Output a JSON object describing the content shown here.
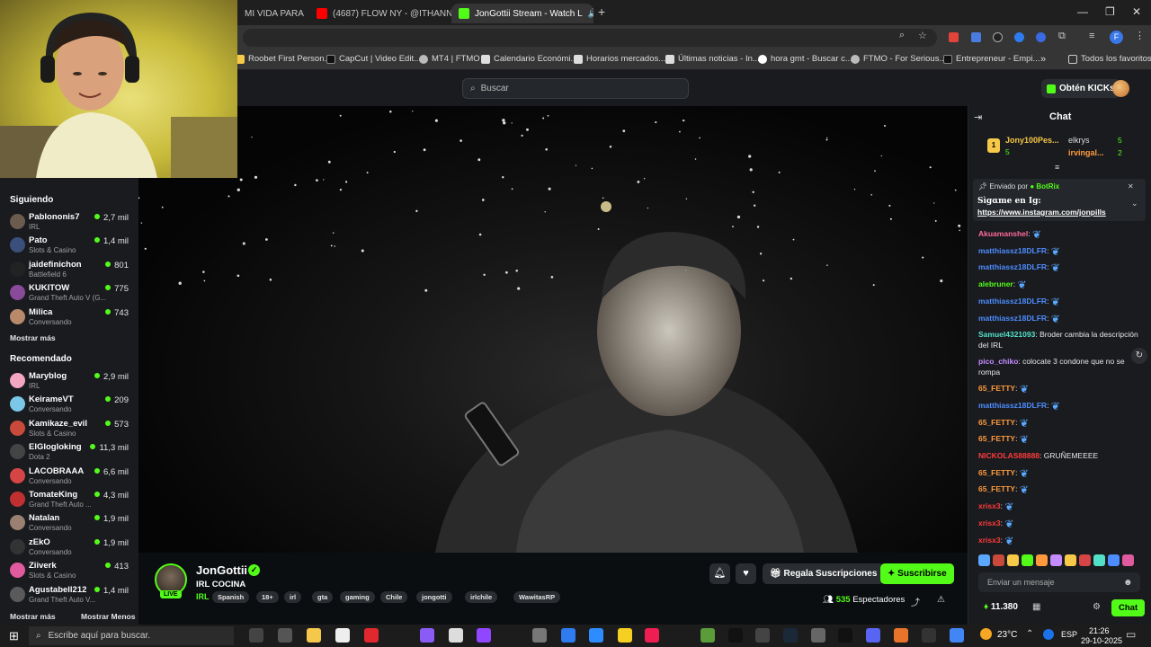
{
  "browser": {
    "tabs": [
      {
        "label": "MI VIDA PARA L",
        "active": false
      },
      {
        "label": "(4687) FLOW NY - @ITHANNY",
        "active": false
      },
      {
        "label": "JonGottii Stream - Watch L",
        "active": true
      }
    ],
    "bookmarks": [
      "Roobet First Person...",
      "CapCut | Video Edit...",
      "MT4 | FTMO",
      "Calendario Económi...",
      "Horarios mercados...",
      "Últimas noticias - In...",
      "hora gmt - Buscar c...",
      "FTMO - For Serious...",
      "Entrepreneur - Empi..."
    ],
    "all_favorites": "Todos los favoritos",
    "more": "»"
  },
  "header": {
    "search_placeholder": "Buscar",
    "kicks_button": "Obtén KICKs"
  },
  "sidebar": {
    "following_title": "Siguiendo",
    "following": [
      {
        "name": "Pablononis7",
        "category": "IRL",
        "viewers": "2,7 mil",
        "color": "#6b5c4e"
      },
      {
        "name": "Pato",
        "category": "Slots & Casino",
        "viewers": "1,4 mil",
        "color": "#3a4f7a"
      },
      {
        "name": "jaidefinichon",
        "category": "Battlefield 6",
        "viewers": "801",
        "color": "#222"
      },
      {
        "name": "KUKITOW",
        "category": "Grand Theft Auto V (G...",
        "viewers": "775",
        "color": "#8a4a9a"
      },
      {
        "name": "Milica",
        "category": "Conversando",
        "viewers": "743",
        "color": "#b88a6a"
      }
    ],
    "following_more": "Mostrar más",
    "recommended_title": "Recomendado",
    "recommended": [
      {
        "name": "Maryblog",
        "category": "IRL",
        "viewers": "2,9 mil",
        "color": "#f2a6c0"
      },
      {
        "name": "KeirameVT",
        "category": "Conversando",
        "viewers": "209",
        "color": "#7ac7e8"
      },
      {
        "name": "Kamikaze_evil",
        "category": "Slots & Casino",
        "viewers": "573",
        "color": "#c94a3a"
      },
      {
        "name": "ElGlogloking",
        "category": "Dota 2",
        "viewers": "11,3 mil",
        "color": "#444"
      },
      {
        "name": "LACOBRAAA",
        "category": "Conversando",
        "viewers": "6,6 mil",
        "color": "#d64545"
      },
      {
        "name": "TomateKing",
        "category": "Grand Theft Auto ...",
        "viewers": "4,3 mil",
        "color": "#c03030"
      },
      {
        "name": "Natalan",
        "category": "Conversando",
        "viewers": "1,9 mil",
        "color": "#9a8070"
      },
      {
        "name": "zEkO",
        "category": "Conversando",
        "viewers": "1,9 mil",
        "color": "#333"
      },
      {
        "name": "Ziiverk",
        "category": "Slots & Casino",
        "viewers": "413",
        "color": "#e05aa0"
      },
      {
        "name": "Agustabell212",
        "category": "Grand Theft Auto V...",
        "viewers": "1,4 mil",
        "color": "#5a5a5a"
      }
    ],
    "show_more": "Mostrar más",
    "show_less": "Mostrar Menos"
  },
  "stream": {
    "streamer": "JonGottii",
    "title": "IRL COCINA",
    "category": "IRL",
    "live_badge": "LIVE",
    "tags": [
      "Spanish",
      "18+",
      "irl",
      "gta",
      "gaming",
      "Chile",
      "jongotti",
      "irlchile",
      "WawitasRP"
    ],
    "gift_button": "Regala Suscripciones",
    "subscribe_button": "Suscribirse",
    "viewers_count": "535",
    "viewers_label": "Espectadores"
  },
  "chat": {
    "title": "Chat",
    "leaderboard": [
      {
        "name": "Jony100Pes...",
        "value": "5"
      },
      {
        "name": "elkrys",
        "value": "5"
      },
      {
        "name": "irvingal...",
        "value": "2"
      }
    ],
    "pinned_by_prefix": "Enviado por",
    "pinned_by": "BotRix",
    "pinned_text": "Sìgαme en Ig:",
    "pinned_link": "https://www.instagram.com/jonpills",
    "messages": [
      {
        "user": "Akuamanshel",
        "color": "#ff6b9a",
        "text": ""
      },
      {
        "user": "matthiassz18DLFR",
        "color": "#4d8dff",
        "text": ""
      },
      {
        "user": "matthiassz18DLFR",
        "color": "#4d8dff",
        "text": ""
      },
      {
        "user": "alebruner",
        "color": "#53fc18",
        "text": ""
      },
      {
        "user": "matthiassz18DLFR",
        "color": "#4d8dff",
        "text": ""
      },
      {
        "user": "matthiassz18DLFR",
        "color": "#4d8dff",
        "text": ""
      },
      {
        "user": "Samuel4321093",
        "color": "#53e0c8",
        "text": "Broder cambia la descripción del IRL"
      },
      {
        "user": "pico_chiko",
        "color": "#c58cff",
        "text": "colocate 3 condone   que no se rompa"
      },
      {
        "user": "65_FETTY",
        "color": "#ff9a3c",
        "text": ""
      },
      {
        "user": "matthiassz18DLFR",
        "color": "#4d8dff",
        "text": ""
      },
      {
        "user": "65_FETTY",
        "color": "#ff9a3c",
        "text": ""
      },
      {
        "user": "65_FETTY",
        "color": "#ff9a3c",
        "text": ""
      },
      {
        "user": "NICKOLAS88888",
        "color": "#ff3b3b",
        "text": "GRUÑEMEEEE"
      },
      {
        "user": "65_FETTY",
        "color": "#ff9a3c",
        "text": ""
      },
      {
        "user": "65_FETTY",
        "color": "#ff9a3c",
        "text": ""
      },
      {
        "user": "xrisx3",
        "color": "#ff3b3b",
        "text": ""
      },
      {
        "user": "xrisx3",
        "color": "#ff3b3b",
        "text": ""
      },
      {
        "user": "xrisx3",
        "color": "#ff3b3b",
        "text": ""
      }
    ],
    "input_placeholder": "Enviar un mensaje",
    "points": "11.380",
    "send_button": "Chat"
  },
  "taskbar": {
    "search_placeholder": "Escribe aquí para buscar.",
    "temperature": "23°C",
    "language": "ESP",
    "time": "21:26",
    "date": "29-10-2025"
  },
  "colors": {
    "accent": "#53fc18",
    "background": "#0b0e11",
    "panel": "#191b1f"
  }
}
